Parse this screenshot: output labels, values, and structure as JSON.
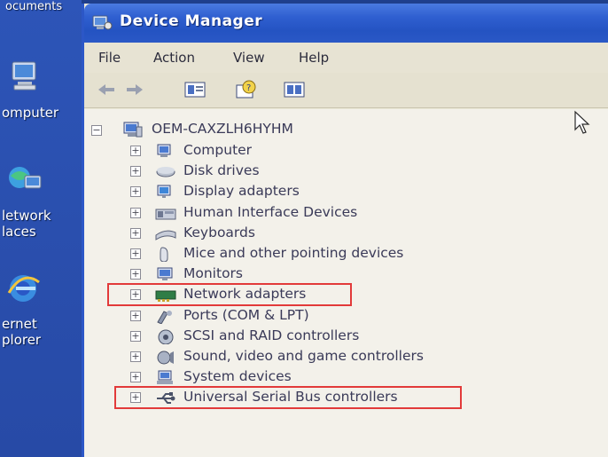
{
  "desktop": {
    "items": [
      {
        "label": "ocuments"
      },
      {
        "label": "omputer"
      },
      {
        "label": "letwork"
      },
      {
        "label": "laces"
      },
      {
        "label": "ernet"
      },
      {
        "label": "plorer"
      }
    ]
  },
  "window": {
    "title": "Device Manager",
    "menu": [
      "File",
      "Action",
      "View",
      "Help"
    ],
    "toolbar_icons": [
      "back-arrow-icon",
      "forward-arrow-icon",
      "properties-icon",
      "help-icon",
      "view-icon"
    ],
    "tree": {
      "root": "OEM-CAXZLH6HYHM",
      "expander_symbol": "+",
      "root_expander_symbol": "−",
      "nodes": [
        {
          "label": "Computer",
          "icon": "computer-icon",
          "highlighted": false
        },
        {
          "label": "Disk drives",
          "icon": "disk-drive-icon",
          "highlighted": false
        },
        {
          "label": "Display adapters",
          "icon": "display-adapter-icon",
          "highlighted": false
        },
        {
          "label": "Human Interface Devices",
          "icon": "hid-icon",
          "highlighted": false
        },
        {
          "label": "Keyboards",
          "icon": "keyboard-icon",
          "highlighted": false
        },
        {
          "label": "Mice and other pointing devices",
          "icon": "mouse-icon",
          "highlighted": false
        },
        {
          "label": "Monitors",
          "icon": "monitor-icon",
          "highlighted": false
        },
        {
          "label": "Network adapters",
          "icon": "network-adapter-icon",
          "highlighted": true
        },
        {
          "label": "Ports (COM & LPT)",
          "icon": "port-icon",
          "highlighted": false
        },
        {
          "label": "SCSI and RAID controllers",
          "icon": "scsi-icon",
          "highlighted": false
        },
        {
          "label": "Sound, video and game controllers",
          "icon": "sound-icon",
          "highlighted": false
        },
        {
          "label": "System devices",
          "icon": "system-device-icon",
          "highlighted": false
        },
        {
          "label": "Universal Serial Bus controllers",
          "icon": "usb-icon",
          "highlighted": true
        }
      ]
    }
  },
  "colors": {
    "titlebar": "#2f5fd0",
    "highlight_box": "#e23a3a",
    "window_bg": "#ece9d8"
  }
}
